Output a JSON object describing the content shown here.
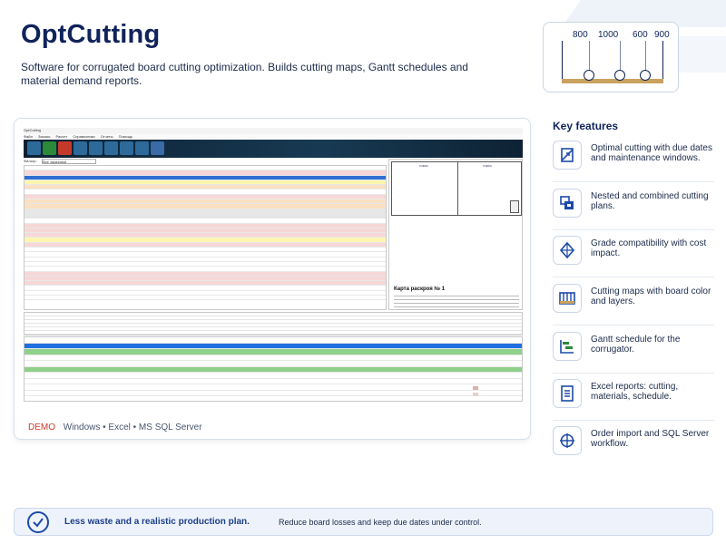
{
  "header": {
    "title": "OptCutting",
    "subtitle": "Software for corrugated board cutting optimization. Builds cutting maps, Gantt schedules and material demand reports."
  },
  "cutting_diagram": {
    "widths": [
      "800",
      "1000",
      "600",
      "900"
    ]
  },
  "screenshot": {
    "window_title": "OptCutting",
    "menu": [
      "Файл",
      "Заказы",
      "Расчет",
      "Справочники",
      "Отчеты",
      "Помощь"
    ],
    "filter_label": "Фильтр:",
    "filter_value": "Все заказчики",
    "preview_title": "Карта раскроя № 1",
    "preview_cells": [
      "ГОФРА",
      "ГОФРА"
    ],
    "toolbar_colors": [
      "#2d6a9a",
      "#2a8a3a",
      "#c43a2a",
      "#2d6a9a",
      "#2d6a9a",
      "#2d6a9a",
      "#2d6a9a",
      "#2d6a9a",
      "#3a6aa8"
    ],
    "order_row_colors": [
      "#ffffff",
      "#f7d7d7",
      "#2f6fd2",
      "#fff5b0",
      "#fbe0c2",
      "#ffffff",
      "#f7d7d7",
      "#fbe0c2",
      "#fbe0c2",
      "#e6e6e6",
      "#e6e6e6",
      "#ffffff",
      "#f7d7d7",
      "#f7d7d7",
      "#f7d7d7",
      "#fff5b0",
      "#f7d7d7",
      "#ffffff",
      "#ffffff",
      "#ffffff",
      "#ffffff",
      "#ffffff",
      "#f7d7d7",
      "#f7d7d7",
      "#f7d7d7",
      "#ffffff",
      "#ffffff",
      "#ffffff"
    ],
    "gantt_row_colors": [
      "#ffffff",
      "#1f6fe0",
      "#8fd08a",
      "#ffffff",
      "#ffffff",
      "#8fd08a",
      "#ffffff",
      "#ffffff",
      "#ffffff",
      "#ffffff"
    ],
    "caption_demo": "DEMO",
    "caption_platform": "Windows • Excel • MS SQL Server"
  },
  "features": {
    "title": "Key features",
    "items": [
      {
        "text": "Optimal cutting with due dates and maintenance windows.",
        "icon": "optimal-cutting-icon"
      },
      {
        "text": "Nested and combined cutting plans.",
        "icon": "nested-plans-icon"
      },
      {
        "text": "Grade compatibility with cost impact.",
        "icon": "grade-compatibility-icon"
      },
      {
        "text": "Cutting maps with board color and layers.",
        "icon": "cutting-map-icon"
      },
      {
        "text": "Gantt schedule for the corrugator.",
        "icon": "gantt-icon"
      },
      {
        "text": "Excel reports: cutting, materials, schedule.",
        "icon": "excel-report-icon"
      },
      {
        "text": "Order import and SQL Server workflow.",
        "icon": "order-import-icon"
      }
    ]
  },
  "banner": {
    "headline": "Less waste and a realistic production plan.",
    "description": "Reduce board losses and keep due dates under control."
  },
  "colors": {
    "brand_navy": "#10235a",
    "accent_blue": "#1c4aa8",
    "demo_red": "#d23a2a"
  }
}
